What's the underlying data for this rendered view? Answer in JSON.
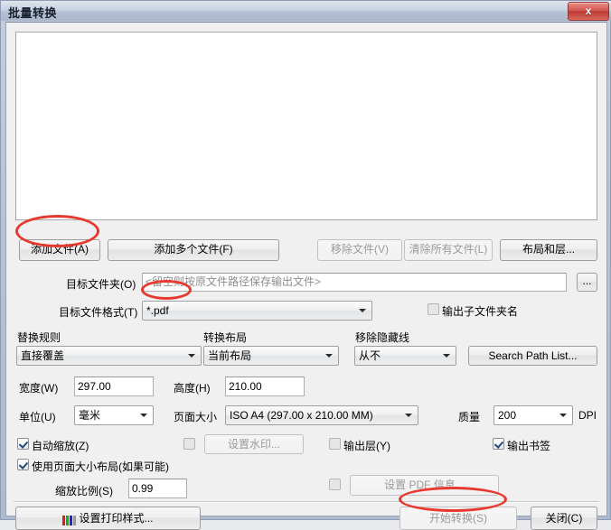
{
  "window": {
    "title": "批量转换",
    "close_label": "x",
    "close_icon": "close-icon"
  },
  "file_list": {
    "items": []
  },
  "toolbar": {
    "add_file": "添加文件(A)",
    "add_multi_files": "添加多个文件(F)",
    "remove_file": "移除文件(V)",
    "clear_all_files": "清除所有文件(L)",
    "layout_and_layer": "布局和层..."
  },
  "target_folder": {
    "label": "目标文件夹(O)",
    "value": "",
    "placeholder": "<留空则按原文件路径保存输出文件>",
    "browse_label": "..."
  },
  "target_format": {
    "label": "目标文件格式(T)",
    "value": "*.pdf"
  },
  "output_subfolder": {
    "label": "输出子文件夹名",
    "checked": false,
    "enabled": false
  },
  "groups": {
    "replace_rule_label": "替换规则",
    "replace_rule_value": "直接覆盖",
    "convert_layout_label": "转换布局",
    "convert_layout_value": "当前布局",
    "remove_hidden_label": "移除隐藏线",
    "remove_hidden_value": "从不",
    "search_path_list": "Search Path List..."
  },
  "page_setup": {
    "width_label": "宽度(W)",
    "width_value": "297.00",
    "height_label": "高度(H)",
    "height_value": "210.00",
    "unit_label": "单位(U)",
    "unit_value": "毫米",
    "page_size_label": "页面大小",
    "page_size_value": "ISO A4 (297.00 x 210.00 MM)",
    "quality_label": "质量",
    "quality_value": "200",
    "dpi_label": "DPI"
  },
  "options": {
    "auto_scale_label": "自动缩放(Z)",
    "auto_scale_checked": true,
    "watermark_button": "设置水印...",
    "watermark_checked": false,
    "output_layer_label": "输出层(Y)",
    "output_layer_checked": false,
    "output_bookmark_label": "输出书签",
    "output_bookmark_checked": true,
    "use_page_size_layout_label": "使用页面大小布局(如果可能)",
    "use_page_size_layout_checked": true,
    "scale_ratio_label": "缩放比例(S)",
    "scale_ratio_value": "0.99",
    "pdf_info_button": "设置 PDF 信息...",
    "pdf_info_checked": false
  },
  "footer": {
    "print_style": "设置打印样式...",
    "start_convert": "开始转换(S)",
    "close": "关闭(C)"
  },
  "colors": {
    "annotation": "#e8392f",
    "title_text": "#16202c",
    "disabled_text": "#9a9a9a",
    "bar_red": "#d41f1f",
    "bar_green": "#1fa51f",
    "bar_blue": "#2222c8",
    "bar_gray": "#9a9a9a"
  }
}
